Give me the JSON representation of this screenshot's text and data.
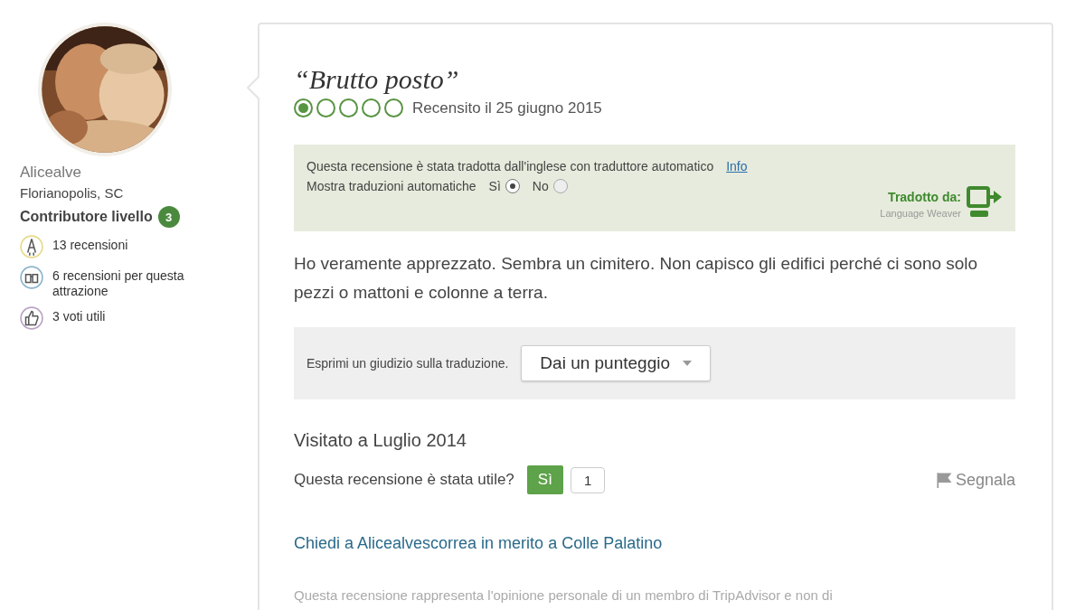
{
  "reviewer": {
    "name": "Alicealve",
    "location": "Florianopolis, SC",
    "level_label": "Contributore livello",
    "level": "3",
    "stats": [
      {
        "kind": "reviews",
        "text": "13 recensioni"
      },
      {
        "kind": "attraction",
        "text": "6 recensioni per questa attrazione"
      },
      {
        "kind": "votes",
        "text": "3 voti utili"
      }
    ]
  },
  "review": {
    "title": "“Brutto posto”",
    "stars": 1,
    "date": "Recensito il 25 giugno 2015",
    "translation": {
      "notice": "Questa recensione è stata tradotta dall'inglese con traduttore automatico",
      "info_link": "Info",
      "toggle_label": "Mostra traduzioni automatiche",
      "options": [
        {
          "label": "Sì",
          "selected": true
        },
        {
          "label": "No",
          "selected": false
        }
      ],
      "translated_by": "Tradotto da:",
      "provider": "Language Weaver"
    },
    "body": "Ho veramente apprezzato. Sembra un cimitero. Non capisco gli edifici perché ci sono solo pezzi o mattoni e colonne a terra.",
    "rate_translation": {
      "label": "Esprimi un giudizio sulla traduzione.",
      "dropdown": "Dai un punteggio"
    },
    "visited": "Visitato a Luglio 2014",
    "helpful": {
      "question": "Questa recensione è stata utile?",
      "button": "Sì",
      "count": "1"
    },
    "report": "Segnala",
    "ask_link": "Chiedi a Alicealvescorrea in merito a Colle Palatino",
    "disclaimer": "Questa recensione rappresenta l'opinione personale di un membro di TripAdvisor e non di"
  }
}
